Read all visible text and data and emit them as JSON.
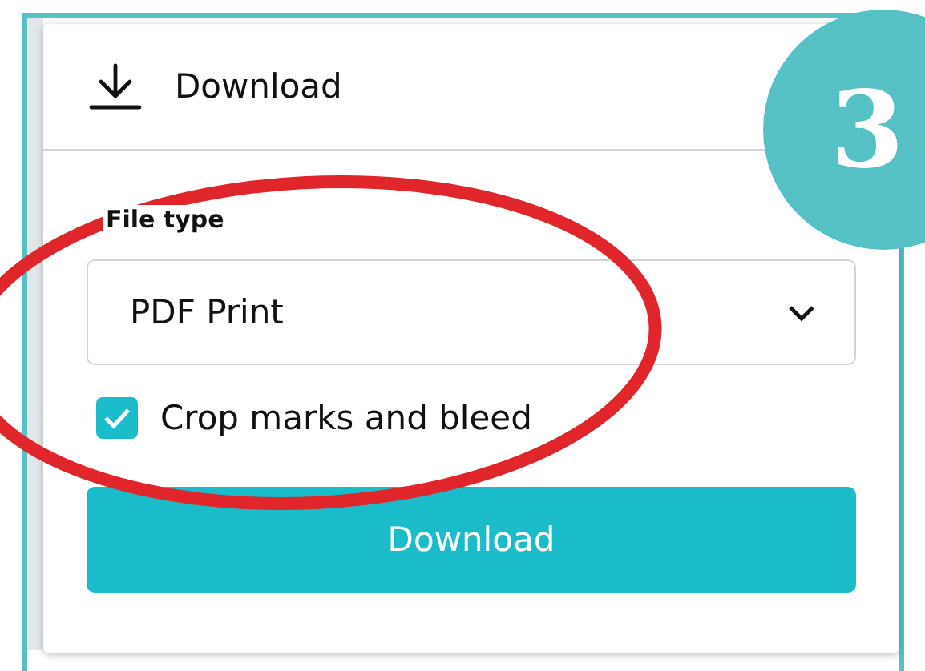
{
  "panel": {
    "title": "Download",
    "file_type": {
      "label": "File type",
      "value": "PDF Print"
    },
    "option": {
      "label": "Crop marks and bleed",
      "checked": true
    },
    "button": "Download"
  },
  "step_badge": "3"
}
